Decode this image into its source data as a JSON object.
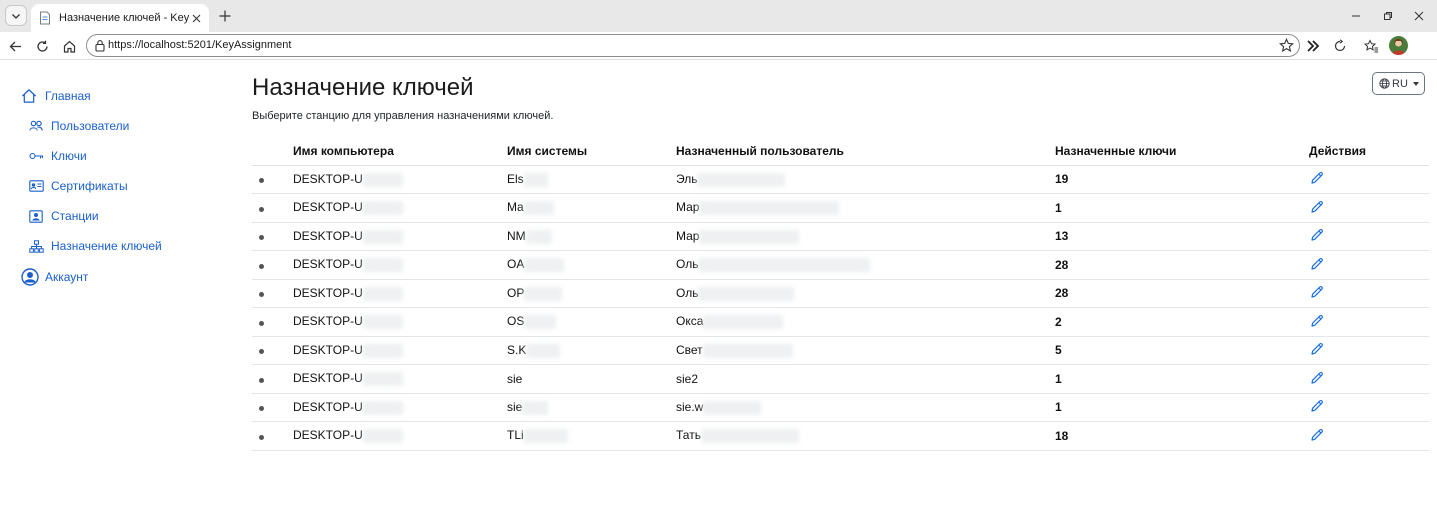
{
  "browser": {
    "tab_title": "Назначение ключей - Key Manag",
    "url": "https://localhost:5201/KeyAssignment"
  },
  "sidebar": {
    "items": [
      {
        "label": "Главная",
        "icon": "home-icon"
      },
      {
        "label": "Пользователи",
        "icon": "users-icon"
      },
      {
        "label": "Ключи",
        "icon": "key-icon"
      },
      {
        "label": "Сертификаты",
        "icon": "certificate-icon"
      },
      {
        "label": "Станции",
        "icon": "station-icon"
      },
      {
        "label": "Назначение ключей",
        "icon": "sitemap-icon"
      },
      {
        "label": "Аккаунт",
        "icon": "account-icon"
      }
    ]
  },
  "page": {
    "title": "Назначение ключей",
    "subtitle": "Выберите станцию для управления назначениями ключей.",
    "language": "RU"
  },
  "table": {
    "headers": [
      "Имя компьютера",
      "Имя системы",
      "Назначенный пользователь",
      "Назначенные ключи",
      "Действия"
    ],
    "rows": [
      {
        "computer": "DESKTOP-U",
        "system": "Els",
        "user": "Эль",
        "keys": "19"
      },
      {
        "computer": "DESKTOP-U",
        "system": "Ma",
        "user": "Мар",
        "keys": "1"
      },
      {
        "computer": "DESKTOP-U",
        "system": "NM",
        "user": "Мар",
        "keys": "13"
      },
      {
        "computer": "DESKTOP-U",
        "system": "OA",
        "user": "Оль",
        "keys": "28"
      },
      {
        "computer": "DESKTOP-U",
        "system": "OP",
        "user": "Оль",
        "keys": "28"
      },
      {
        "computer": "DESKTOP-U",
        "system": "OS",
        "user": "Окса",
        "keys": "2"
      },
      {
        "computer": "DESKTOP-U",
        "system": "S.K",
        "user": "Свет",
        "keys": "5"
      },
      {
        "computer": "DESKTOP-U",
        "system": "sie",
        "user": "sie2",
        "keys": "1"
      },
      {
        "computer": "DESKTOP-U",
        "system": "sie",
        "user": "sie.w",
        "keys": "1"
      },
      {
        "computer": "DESKTOP-U",
        "system": "TLi",
        "user": "Тать",
        "keys": "18"
      }
    ]
  },
  "colors": {
    "link": "#1a5fcc",
    "edit_icon": "#1a6fe0",
    "text": "#212529"
  }
}
